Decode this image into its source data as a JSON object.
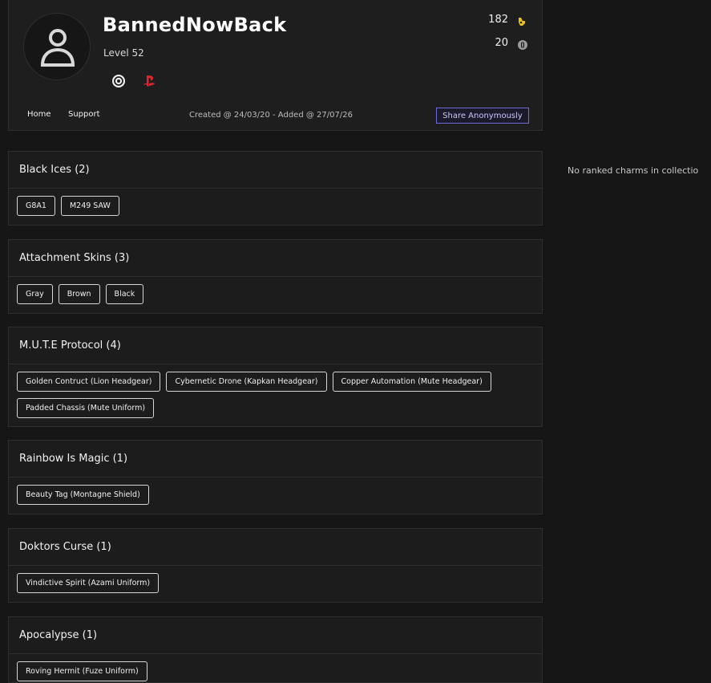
{
  "profile": {
    "username": "BannedNowBack",
    "level": "Level 52",
    "platforms": [
      "ubisoft-icon",
      "playstation-icon"
    ],
    "stats": [
      {
        "value": "182",
        "icon": "charm-icon"
      },
      {
        "value": "20",
        "icon": "coin-icon"
      }
    ],
    "nav": {
      "home": "Home",
      "support": "Support"
    },
    "created_text": "Created @ 24/03/20 - Added @ 27/07/26",
    "share_label": "Share Anonymously"
  },
  "side_note": "No ranked charms in collectio",
  "sections": [
    {
      "title": "Black Ices (2)",
      "items": [
        "G8A1",
        "M249 SAW"
      ]
    },
    {
      "title": "Attachment Skins (3)",
      "items": [
        "Gray",
        "Brown",
        "Black"
      ]
    },
    {
      "title": "M.U.T.E Protocol (4)",
      "items": [
        "Golden Contruct (Lion Headgear)",
        "Cybernetic Drone (Kapkan Headgear)",
        "Copper Automation (Mute Headgear)",
        "Padded Chassis (Mute Uniform)"
      ]
    },
    {
      "title": "Rainbow Is Magic (1)",
      "items": [
        "Beauty Tag (Montagne Shield)"
      ]
    },
    {
      "title": "Doktors Curse (1)",
      "items": [
        "Vindictive Spirit (Azami Uniform)"
      ]
    },
    {
      "title": "Apocalypse (1)",
      "items": [
        "Roving Hermit (Fuze Uniform)"
      ]
    }
  ],
  "colors": {
    "background": "#161616",
    "card": "#1e1e1e",
    "border": "#2e2e2e",
    "accent": "#6c6cd8",
    "psn_red": "#e0262c",
    "charm_yellow": "#e8c21a"
  }
}
